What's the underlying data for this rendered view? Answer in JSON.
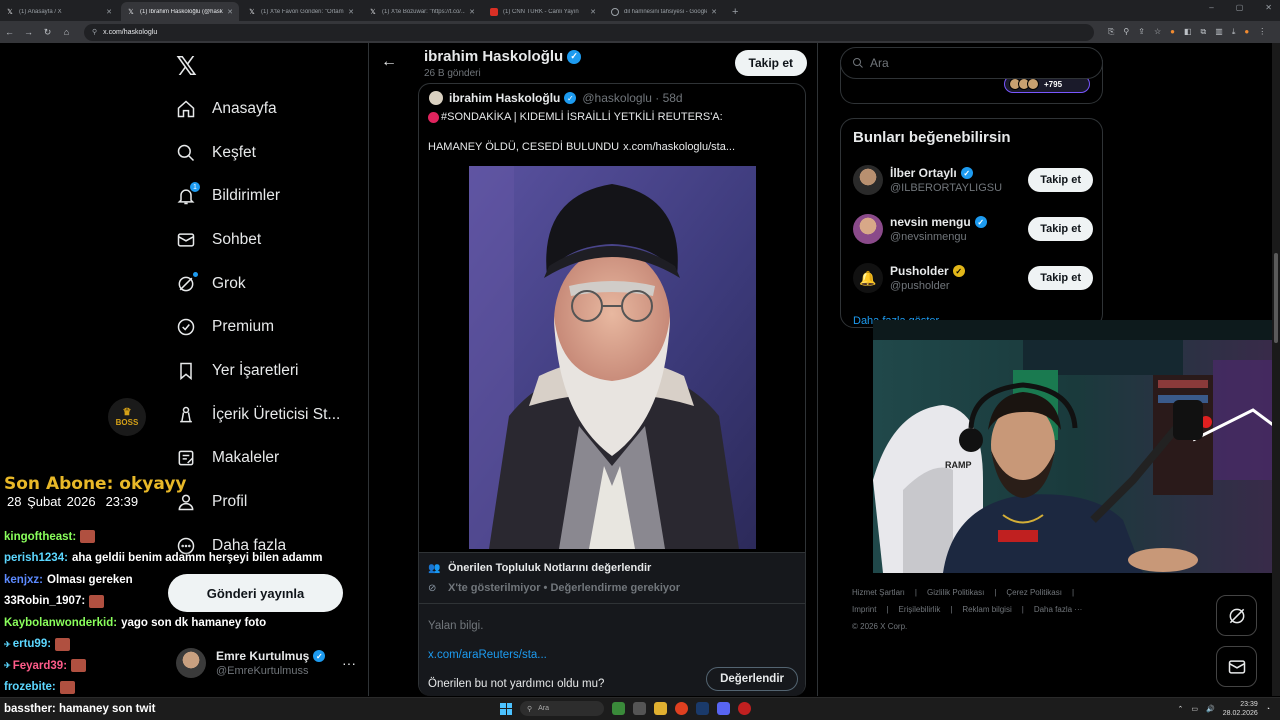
{
  "browser": {
    "tabs": [
      {
        "title": "(1) Anasayfa / X",
        "icon": "x"
      },
      {
        "title": "(1) İbrahim Haskoloğlu (@haskolo...",
        "icon": "x",
        "active": true
      },
      {
        "title": "(1) X'te Favori Gönderi: \"Ortamı...",
        "icon": "x"
      },
      {
        "title": "(1) X'te Bozuwar: \"https://t.co/...",
        "icon": "x"
      },
      {
        "title": "(1) CNN TÜRK - Canlı Yayın",
        "icon": "youtube"
      },
      {
        "title": "dil hamnesini tahsiyesi - Google...",
        "icon": "globe"
      }
    ],
    "new_tab": "+",
    "window_controls": [
      "–",
      "▢",
      "✕"
    ],
    "url": "x.com/haskologlu"
  },
  "overlay": {
    "logo_text": "BOSS",
    "sub_label": "Son Abone: okyayy",
    "date": "28 Şubat 2026",
    "time": "23:39",
    "chat": [
      {
        "user": "kingoftheast:",
        "color": "#8aff5c",
        "msg": "",
        "emote": true
      },
      {
        "user": "perish1234:",
        "color": "#5cd7ff",
        "msg": "aha geldii benim adamm herşeyi bilen adamm",
        "emote": false
      },
      {
        "user": "kenjxz:",
        "color": "#5c8aff",
        "msg": "Olması gereken",
        "emote": false
      },
      {
        "user": "33Robin_1907:",
        "color": "#ffffff",
        "msg": "",
        "emote": true
      },
      {
        "user": "Kaybolanwonderkid:",
        "color": "#8aff5c",
        "msg": "yago son dk hamaney foto",
        "emote": false
      },
      {
        "user": "ertu99:",
        "color": "#5cd7ff",
        "msg": "",
        "emote": true,
        "badge": "✈"
      },
      {
        "user": "Feyard39:",
        "color": "#ff5c8a",
        "msg": "",
        "emote": true,
        "badge": "✈"
      },
      {
        "user": "frozebite:",
        "color": "#5cd7ff",
        "msg": "",
        "emote": true
      },
      {
        "user": "bassther:",
        "color": "#ffffff",
        "msg": "hamaney son twit",
        "emote": false
      }
    ]
  },
  "sidebar": {
    "logo": "𝕏",
    "items": [
      {
        "label": "Anasayfa",
        "icon": "home-icon"
      },
      {
        "label": "Keşfet",
        "icon": "search-icon"
      },
      {
        "label": "Bildirimler",
        "icon": "bell-icon",
        "badge": "1"
      },
      {
        "label": "Sohbet",
        "icon": "mail-icon"
      },
      {
        "label": "Grok",
        "icon": "grok-icon"
      },
      {
        "label": "Premium",
        "icon": "premium-icon"
      },
      {
        "label": "Yer İşaretleri",
        "icon": "bookmark-icon"
      },
      {
        "label": "İçerik Üreticisi St...",
        "icon": "creator-icon"
      },
      {
        "label": "Makaleler",
        "icon": "articles-icon"
      },
      {
        "label": "Profil",
        "icon": "profile-icon"
      },
      {
        "label": "Daha fazla",
        "icon": "more-icon"
      }
    ],
    "post_button": "Gönderi yayınla",
    "account": {
      "name": "Emre Kurtulmuş",
      "handle": "@EmreKurtulmuss",
      "more": "···"
    }
  },
  "main": {
    "back": "←",
    "title": "ibrahim Haskoloğlu",
    "post_count": "26 B gönderi",
    "follow": "Takip et",
    "tweet": {
      "name": "ibrahim Haskoloğlu",
      "handle": "@haskologlu · 58d",
      "line1": "#SONDAKİKA | KIDEMLİ İSRAİLLİ YETKİLİ REUTERS'A:",
      "line2": "HAMANEY ÖLDÜ, CESEDİ BULUNDU",
      "link": "x.com/haskologlu/sta..."
    },
    "community_note": {
      "title": "Önerilen Topluluk Notlarını değerlendir",
      "subtitle": "X'te gösterilmiyor • Değerlendirme gerekiyor",
      "note": "Yalan bilgi.",
      "link": "x.com/araReuters/sta...",
      "question": "Önerilen bu not yardımcı oldu mu?",
      "rate_button": "Değerlendir"
    }
  },
  "right": {
    "search_placeholder": "Ara",
    "prev_count": "+795",
    "who_to_follow": {
      "title": "Bunları beğenebilirsin",
      "items": [
        {
          "name": "İlber Ortaylı",
          "handle": "@ILBERORTAYLIGSU",
          "check": "blue",
          "button": "Takip et"
        },
        {
          "name": "nevsin mengu",
          "handle": "@nevsinmengu",
          "check": "blue",
          "button": "Takip et"
        },
        {
          "name": "Pusholder",
          "handle": "@pusholder",
          "check": "gold",
          "button": "Takip et"
        }
      ],
      "more": "Daha fazla göster"
    },
    "footer": {
      "line1": [
        "Hizmet Şartları",
        "|",
        "Gizlilik Politikası",
        "|",
        "Çerez Politikası",
        "|"
      ],
      "line2": [
        "Imprint",
        "|",
        "Erişilebilirlik",
        "|",
        "Reklam bilgisi",
        "|",
        "Daha fazla ···"
      ],
      "line3": "© 2026 X Corp."
    }
  },
  "taskbar": {
    "search": "Ara",
    "time": "23:39",
    "date": "28.02.2026"
  },
  "colors": {
    "accent": "#1d9bf0",
    "background": "#000000",
    "gold": "#e8b828"
  }
}
